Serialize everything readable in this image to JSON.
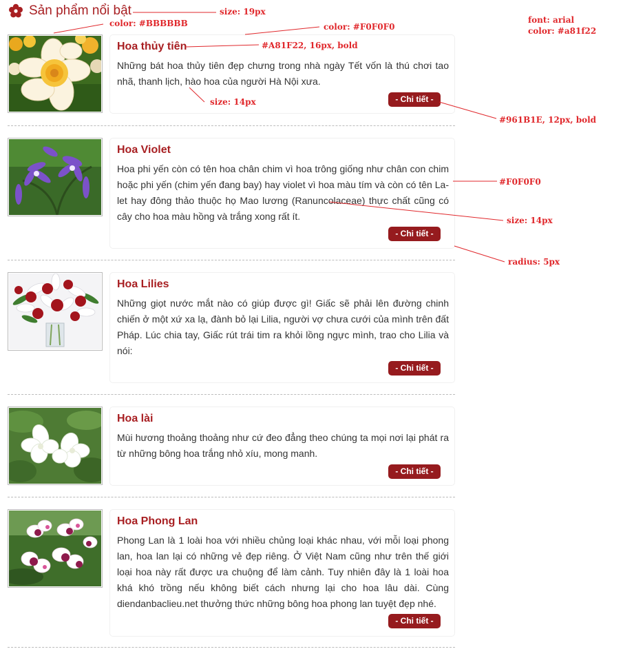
{
  "section": {
    "title": "Sản phẩm nổi bật",
    "icon": "flower-icon",
    "icon_color": "#a81f22"
  },
  "colors": {
    "border": "#BBBBBB",
    "card_border": "#F0F0F0",
    "title": "#A81F22",
    "button": "#961B1E"
  },
  "products": [
    {
      "name": "Hoa thủy tiên",
      "description": "Những bát hoa thủy tiên đẹp chưng trong nhà ngày Tết vốn là thú chơi tao nhã, thanh lịch, hào hoa của người Hà Nội xưa.",
      "button": "- Chi tiết -",
      "image_icon": "daffodil-photo"
    },
    {
      "name": "Hoa Violet",
      "description": "Hoa phi yến còn có tên hoa chân chim vì hoa trông giống như chân con chim hoặc phi yến (chim yến đang bay) hay violet vì hoa màu tím và còn có tên La-let hay đông thảo thuộc họ Mao lương (Ranuncolaceae) thực chất cũng có cây cho hoa màu hồng và trắng xong rất ít.",
      "button": "- Chi tiết -",
      "image_icon": "violet-photo"
    },
    {
      "name": "Hoa Lilies",
      "description": "Những giọt nước mắt nào có giúp được gì! Giấc sẽ phải lên đường chinh chiến ở một xứ xa lạ, đành bỏ lại Lilia, người vợ chưa cưới của mình trên đất Pháp. Lúc chia tay, Giấc rút trái tim ra khỏi lồng ngực mình, trao cho Lilia và nói:",
      "button": "- Chi tiết -",
      "image_icon": "lilies-photo"
    },
    {
      "name": "Hoa lài",
      "description": "Mùi hương thoảng thoảng như cứ đeo đẳng theo chúng ta mọi nơi lại phát ra từ những bông hoa trắng nhỏ xíu, mong manh.",
      "button": "- Chi tiết -",
      "image_icon": "jasmine-photo"
    },
    {
      "name": "Hoa Phong Lan",
      "description": "Phong Lan là 1 loài hoa với nhiều chủng loại khác nhau, với mỗi loại phong lan, hoa lan lại có những vẻ đẹp riêng. Ở Việt Nam cũng như trên thế giới loại hoa này rất được ưa chuộng để làm cảnh. Tuy nhiên đây là 1 loài hoa khá khó trồng nếu không biết cách nhưng lại cho hoa lâu dài. Cùng diendanbaclieu.net thưởng thức những bông hoa phong lan tuyệt đẹp nhé.",
      "button": "- Chi tiết -",
      "image_icon": "orchid-photo"
    }
  ],
  "annotations": {
    "title_size": "size: 19px",
    "border_color": "color: #BBBBBB",
    "card_color": "color: #F0F0F0",
    "font_family": "font: arial",
    "font_color": "color: #a81f22",
    "title_style": "#A81F22, 16px, bold",
    "desc_size": "size: 14px",
    "button_style": "#961B1E, 12px, bold",
    "card_color_2": "#F0F0F0",
    "desc_size_2": "size: 14px",
    "radius": "radius: 5px"
  }
}
